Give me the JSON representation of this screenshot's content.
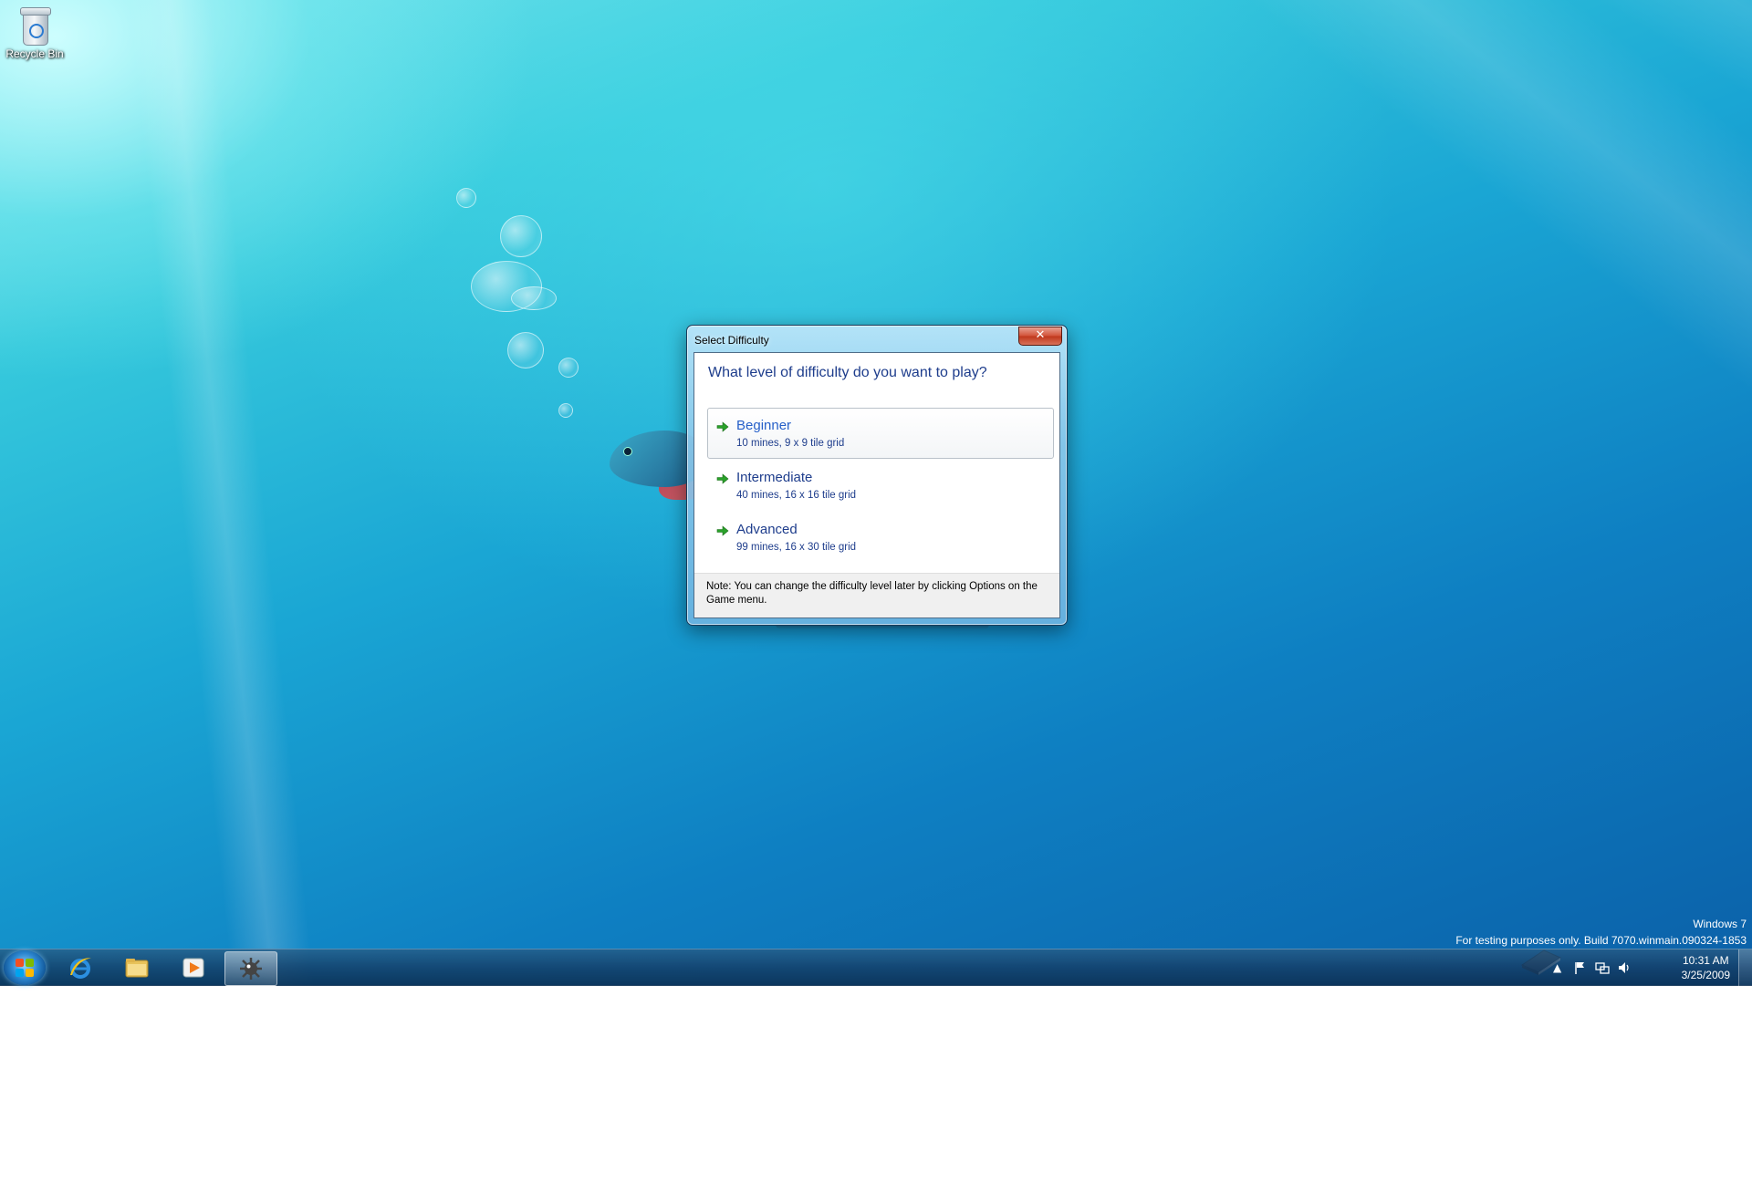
{
  "desktop": {
    "icons": [
      {
        "label": "Recycle Bin"
      }
    ],
    "watermark": {
      "line1": "Windows 7",
      "line2": "For testing purposes only. Build 7070.winmain.090324-1853"
    }
  },
  "dialog": {
    "title": "Select Difficulty",
    "close_label": "✕",
    "question": "What level of difficulty do you want to play?",
    "options": [
      {
        "title": "Beginner",
        "description": "10 mines, 9 x 9 tile grid",
        "selected": true
      },
      {
        "title": "Intermediate",
        "description": "40 mines, 16 x 16 tile grid",
        "selected": false
      },
      {
        "title": "Advanced",
        "description": "99 mines, 16 x 30 tile grid",
        "selected": false
      }
    ],
    "note": "Note: You can change the difficulty level later by clicking Options on the Game menu."
  },
  "taskbar": {
    "pinned": [
      {
        "name": "internet-explorer-icon"
      },
      {
        "name": "windows-explorer-icon"
      },
      {
        "name": "media-player-icon"
      },
      {
        "name": "minesweeper-icon",
        "active": true
      }
    ],
    "clock": {
      "time": "10:31 AM",
      "date": "3/25/2009"
    }
  },
  "colors": {
    "dialog_heading": "#1e3d8c",
    "arrow_green": "#2aa12a",
    "close_red": "#c0381c"
  }
}
